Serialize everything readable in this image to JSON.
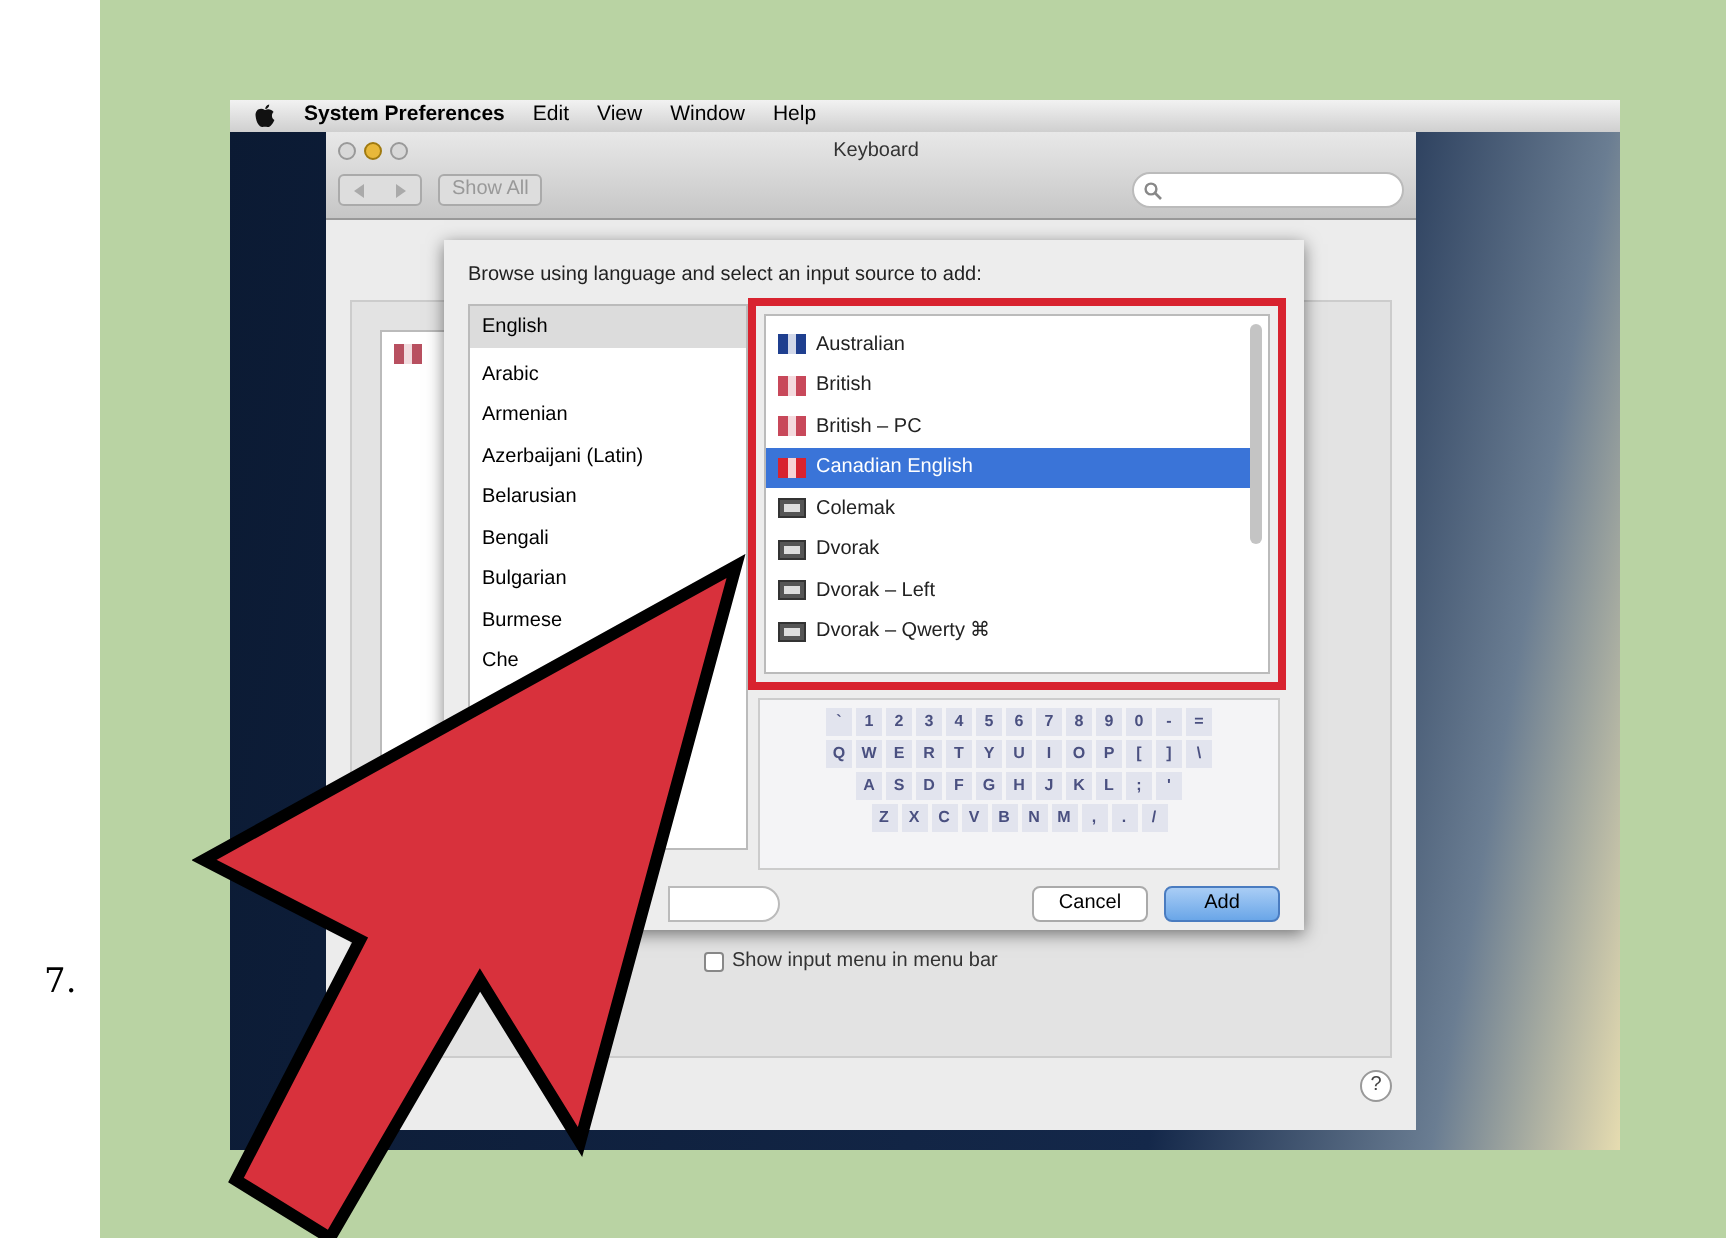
{
  "step_number": "7.",
  "menu_bar": {
    "items": [
      "System Preferences",
      "Edit",
      "View",
      "Window",
      "Help"
    ]
  },
  "window": {
    "title": "Keyboard",
    "show_all": "Show All"
  },
  "sheet": {
    "prompt": "Browse using language and select an input source to add:",
    "languages": [
      {
        "label": "English",
        "selected": true
      },
      {
        "label": "Arabic",
        "selected": false
      },
      {
        "label": "Armenian",
        "selected": false
      },
      {
        "label": "Azerbaijani (Latin)",
        "selected": false
      },
      {
        "label": "Belarusian",
        "selected": false
      },
      {
        "label": "Bengali",
        "selected": false
      },
      {
        "label": "Bulgarian",
        "selected": false
      },
      {
        "label": "Burmese",
        "selected": false
      },
      {
        "label": "Che",
        "selected": false
      }
    ],
    "input_sources": [
      {
        "label": "Australian",
        "selected": false,
        "kind": "flag",
        "color": "#1f3f8f"
      },
      {
        "label": "British",
        "selected": false,
        "kind": "flag",
        "color": "#c8485a"
      },
      {
        "label": "British – PC",
        "selected": false,
        "kind": "flag",
        "color": "#c8485a"
      },
      {
        "label": "Canadian English",
        "selected": true,
        "kind": "flag",
        "color": "#d8232f"
      },
      {
        "label": "Colemak",
        "selected": false,
        "kind": "keyboard"
      },
      {
        "label": "Dvorak",
        "selected": false,
        "kind": "keyboard"
      },
      {
        "label": "Dvorak – Left",
        "selected": false,
        "kind": "keyboard"
      },
      {
        "label": "Dvorak – Qwerty ⌘",
        "selected": false,
        "kind": "keyboard"
      }
    ],
    "keyboard_rows": [
      [
        "`",
        "1",
        "2",
        "3",
        "4",
        "5",
        "6",
        "7",
        "8",
        "9",
        "0",
        "-",
        "="
      ],
      [
        "Q",
        "W",
        "E",
        "R",
        "T",
        "Y",
        "U",
        "I",
        "O",
        "P",
        "[",
        "]",
        "\\"
      ],
      [
        "A",
        "S",
        "D",
        "F",
        "G",
        "H",
        "J",
        "K",
        "L",
        ";",
        "'"
      ],
      [
        "Z",
        "X",
        "C",
        "V",
        "B",
        "N",
        "M",
        ",",
        ".",
        "/"
      ]
    ],
    "buttons": [
      {
        "label": "Cancel",
        "default": false
      },
      {
        "label": "Add",
        "default": true
      }
    ]
  },
  "show_input_menu": {
    "label": "Show input menu in menu bar",
    "checked": false
  },
  "help": "?"
}
